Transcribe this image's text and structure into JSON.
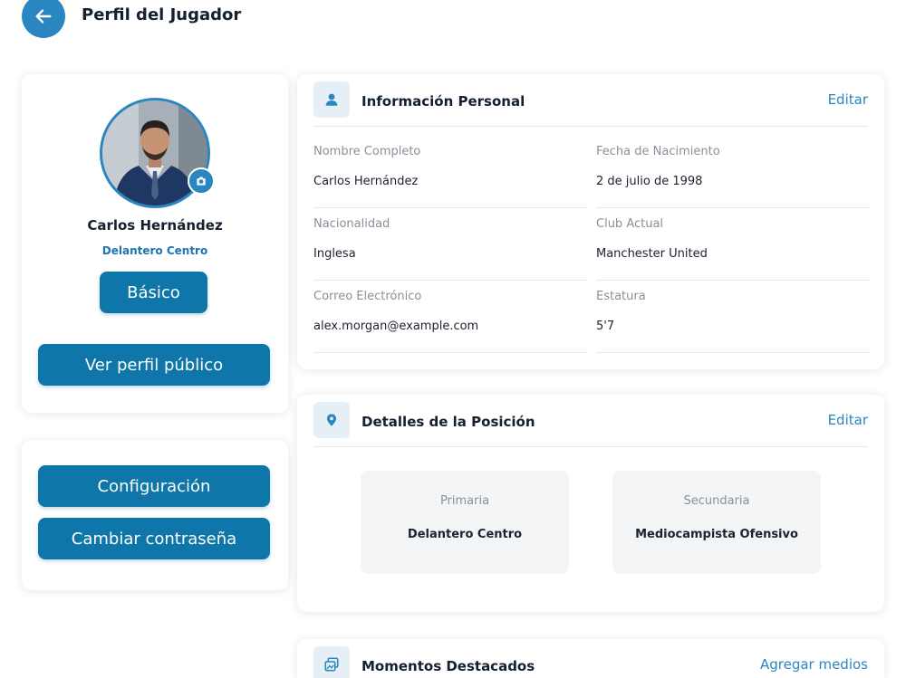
{
  "header": {
    "title": "Perfil del Jugador",
    "back_icon": "arrow-left-icon"
  },
  "profile": {
    "name": "Carlos Hernández",
    "position": "Delantero Centro",
    "plan_badge": "Básico",
    "public_profile_button": "Ver perfil público",
    "camera_icon": "camera-icon"
  },
  "account": {
    "settings_button": "Configuración",
    "change_password_button": "Cambiar contraseña"
  },
  "personal_info": {
    "title": "Información Personal",
    "edit_label": "Editar",
    "fields": [
      {
        "label": "Nombre Completo",
        "value": "Carlos Hernández"
      },
      {
        "label": "Fecha de Nacimiento",
        "value": "2 de julio de 1998"
      },
      {
        "label": "Nacionalidad",
        "value": "Inglesa"
      },
      {
        "label": "Club Actual",
        "value": "Manchester United"
      },
      {
        "label": "Correo Electrónico",
        "value": "alex.morgan@example.com"
      },
      {
        "label": "Estatura",
        "value": "5'7"
      }
    ]
  },
  "position_details": {
    "title": "Detalles de la Posición",
    "edit_label": "Editar",
    "primary_label": "Primaria",
    "primary_value": "Delantero Centro",
    "secondary_label": "Secundaria",
    "secondary_value": "Mediocampista Ofensivo"
  },
  "highlights": {
    "title": "Momentos Destacados",
    "add_media_label": "Agregar medios"
  },
  "colors": {
    "accent": "#2a86c0",
    "button": "#0e76a8",
    "text": "#14202e",
    "muted": "#8a9099"
  }
}
